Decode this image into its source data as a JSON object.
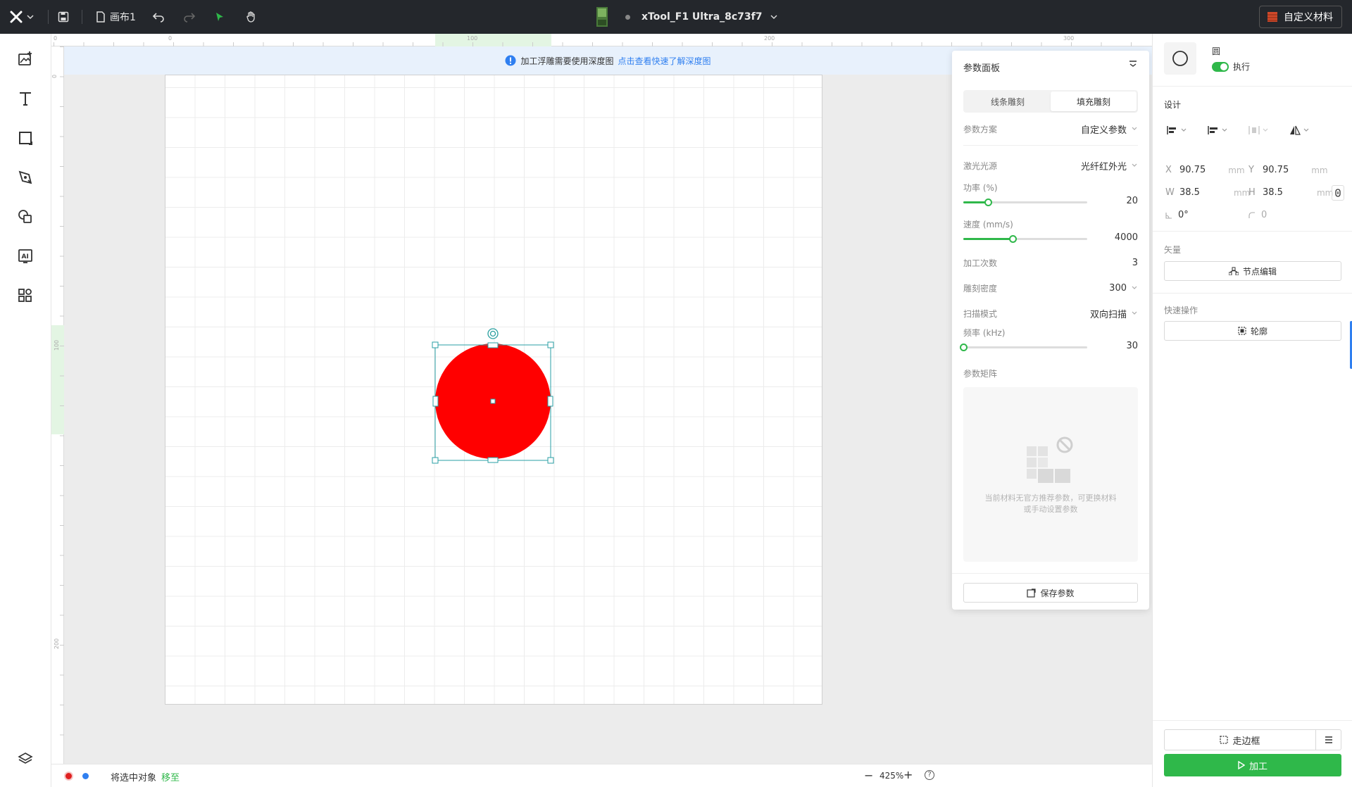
{
  "topbar": {
    "canvas_name": "画布1",
    "device_name": "xTool_F1 Ultra_8c73f7",
    "custom_material": "自定义材料",
    "colors": {
      "background": "#24272c",
      "active_tool": "#2fb84a"
    }
  },
  "left_toolbar": {
    "tools": [
      "image-add-icon",
      "text-icon",
      "shape-square-icon",
      "pen-icon",
      "shapes-icon",
      "ai-icon",
      "apps-icon"
    ],
    "layers": "layers-icon"
  },
  "canvas": {
    "ruler_top_ticks": [
      "0",
      "0",
      "100",
      "200",
      "300"
    ],
    "ruler_left_ticks": [
      "0",
      "100",
      "200"
    ],
    "info": {
      "text": "加工浮雕需要使用深度图",
      "link": "点击查看快速了解深度图"
    },
    "shape": {
      "fill": "#ff0000",
      "type": "circle"
    }
  },
  "param_panel": {
    "title": "参数面板",
    "tabs": [
      {
        "label": "线条雕刻",
        "active": false
      },
      {
        "label": "填充雕刻",
        "active": true
      }
    ],
    "scheme_label": "参数方案",
    "scheme_value": "自定义参数",
    "laser_label": "激光光源",
    "laser_value": "光纤红外光",
    "power": {
      "label": "功率 (%)",
      "value": "20",
      "fraction": 0.2
    },
    "speed": {
      "label": "速度 (mm/s)",
      "value": "4000",
      "fraction": 0.4
    },
    "passes": {
      "label": "加工次数",
      "value": "3"
    },
    "density": {
      "label": "雕刻密度",
      "value": "300"
    },
    "scan_mode": {
      "label": "扫描模式",
      "value": "双向扫描"
    },
    "frequency": {
      "label": "频率 (kHz)",
      "value": "30",
      "fraction": 0.0
    },
    "matrix_label": "参数矩阵",
    "empty_text_1": "当前材料无官方推荐参数，可更换材料",
    "empty_text_2": "或手动设置参数",
    "save_label": "保存参数"
  },
  "right_panel": {
    "object_name": "圆",
    "execute_label": "执行",
    "design_label": "设计",
    "x_label": "X",
    "x_value": "90.75",
    "y_label": "Y",
    "y_value": "90.75",
    "w_label": "W",
    "w_value": "38.5",
    "h_label": "H",
    "h_value": "38.5",
    "unit": "mm",
    "rotation": "0°",
    "corner": "0",
    "vector_label": "矢量",
    "node_edit_label": "节点编辑",
    "quick_ops_label": "快速操作",
    "outline_label": "轮廓",
    "frame_label": "走边框",
    "process_label": "加工",
    "colors": {
      "process": "#2fb84a"
    }
  },
  "status_bar": {
    "text": "将选中对象",
    "move_to": "移至",
    "zoom": "425%",
    "dot_colors": [
      "#e02020",
      "#2f7ff0"
    ]
  }
}
